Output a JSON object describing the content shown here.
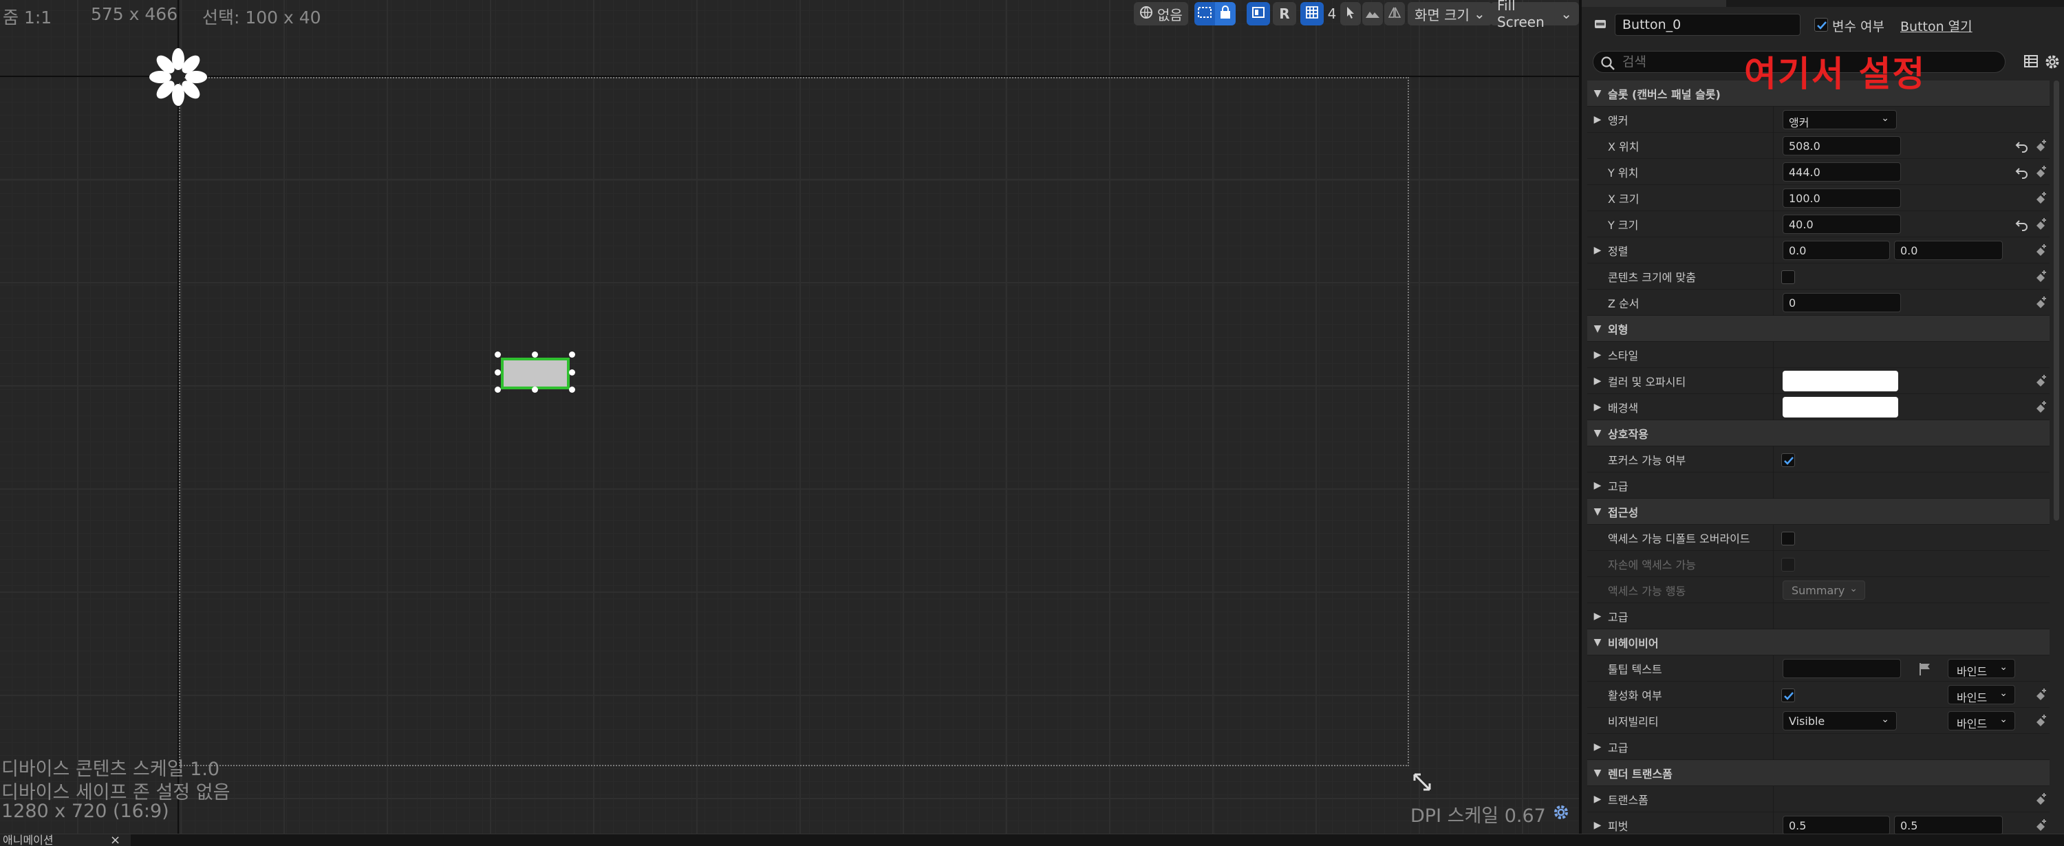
{
  "designer": {
    "zoom": "줌 1:1",
    "dims": "575 x 466",
    "selection": "선택: 100 x 40",
    "toolbar": {
      "none_label": "없음",
      "r_label": "R",
      "grid_count": "4",
      "screen_size_label": "화면 크기",
      "fill_screen_label": "Fill Screen"
    },
    "device_scale": "디바이스 콘텐츠 스케일 1.0",
    "safe_zone": "디바이스 세이프 존 설정 없음",
    "resolution": "1280 x 720 (16:9)",
    "dpi_scale": "DPI 스케일 0.67"
  },
  "bottom_tab": {
    "label": "애니메이션",
    "close": "×"
  },
  "details": {
    "name_value": "Button_0",
    "is_variable_label": "변수 여부",
    "open_button_label": "Button 열기",
    "search_placeholder": "검색",
    "annotation": "여기서 설정",
    "rows": {
      "slot_cat": "슬롯 (캔버스 패널 슬롯)",
      "anchor_label": "앵커",
      "anchor_value": "앵커",
      "x_pos_label": "X 위치",
      "x_pos_value": "508.0",
      "y_pos_label": "Y 위치",
      "y_pos_value": "444.0",
      "x_size_label": "X 크기",
      "x_size_value": "100.0",
      "y_size_label": "Y 크기",
      "y_size_value": "40.0",
      "align_label": "정렬",
      "align_x": "0.0",
      "align_y": "0.0",
      "size_to_content_label": "콘텐츠 크기에 맞춤",
      "z_order_label": "Z 순서",
      "z_order_value": "0",
      "appearance_cat": "외형",
      "style_label": "스타일",
      "color_opacity_label": "컬러 및 오파시티",
      "background_label": "배경색",
      "interaction_cat": "상호작용",
      "focusable_label": "포커스 가능 여부",
      "advanced_label_1": "고급",
      "accessibility_cat": "접근성",
      "override_access_label": "액세스 가능 디폴트 오버라이드",
      "children_access_label": "자손에 액세스 가능",
      "access_behavior_label": "액세스 가능 행동",
      "access_behavior_value": "Summary",
      "advanced_label_2": "고급",
      "behavior_cat": "비헤이비어",
      "tooltip_label": "툴팁 텍스트",
      "bind_label_1": "바인드",
      "enabled_label": "활성화 여부",
      "bind_label_2": "바인드",
      "visibility_label": "비저빌리티",
      "visibility_value": "Visible",
      "bind_label_3": "바인드",
      "advanced_label_3": "고급",
      "render_transform_cat": "렌더 트랜스폼",
      "transform_label": "트랜스폼",
      "pivot_label": "피벗",
      "pivot_x": "0.5",
      "pivot_y": "0.5"
    }
  }
}
